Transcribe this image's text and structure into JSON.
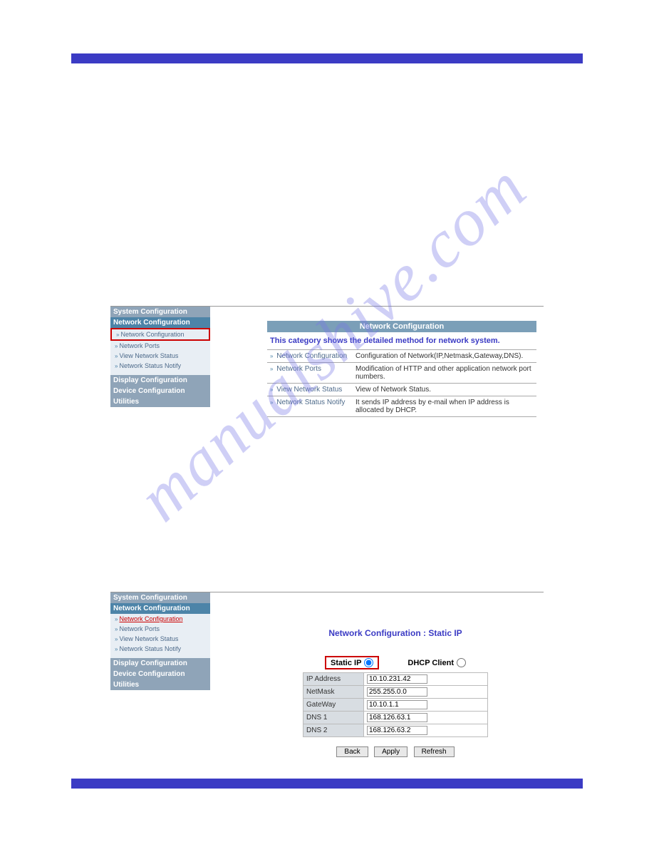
{
  "watermark": "manualshive.com",
  "screenshot1": {
    "sidebar": {
      "headers": {
        "system": "System Configuration",
        "network": "Network Configuration",
        "display": "Display Configuration",
        "device": "Device Configuration",
        "utilities": "Utilities"
      },
      "network_items": {
        "config": "Network Configuration",
        "ports": "Network Ports",
        "status": "View Network Status",
        "notify": "Network Status Notify"
      }
    },
    "content": {
      "title": "Network Configuration",
      "subtitle": "This category shows the detailed method for network system.",
      "rows": [
        {
          "link": "Network Configuration",
          "desc": "Configuration of Network(IP,Netmask,Gateway,DNS)."
        },
        {
          "link": "Network Ports",
          "desc": "Modification of HTTP and other application network port numbers."
        },
        {
          "link": "View Network Status",
          "desc": "View of Network Status."
        },
        {
          "link": "Network Status Notify",
          "desc": "It sends IP address by e-mail when IP address is allocated by DHCP."
        }
      ]
    }
  },
  "screenshot2": {
    "sidebar": {
      "headers": {
        "system": "System Configuration",
        "network": "Network Configuration",
        "display": "Display Configuration",
        "device": "Device Configuration",
        "utilities": "Utilities"
      },
      "network_items": {
        "config": "Network Configuration",
        "ports": "Network Ports",
        "status": "View Network Status",
        "notify": "Network Status Notify"
      }
    },
    "config": {
      "title": "Network Configuration : Static IP",
      "static_label": "Static IP",
      "dhcp_label": "DHCP Client",
      "fields": {
        "ip_label": "IP Address",
        "ip_value": "10.10.231.42",
        "netmask_label": "NetMask",
        "netmask_value": "255.255.0.0",
        "gateway_label": "GateWay",
        "gateway_value": "10.10.1.1",
        "dns1_label": "DNS 1",
        "dns1_value": "168.126.63.1",
        "dns2_label": "DNS 2",
        "dns2_value": "168.126.63.2"
      },
      "buttons": {
        "back": "Back",
        "apply": "Apply",
        "refresh": "Refresh"
      }
    }
  }
}
